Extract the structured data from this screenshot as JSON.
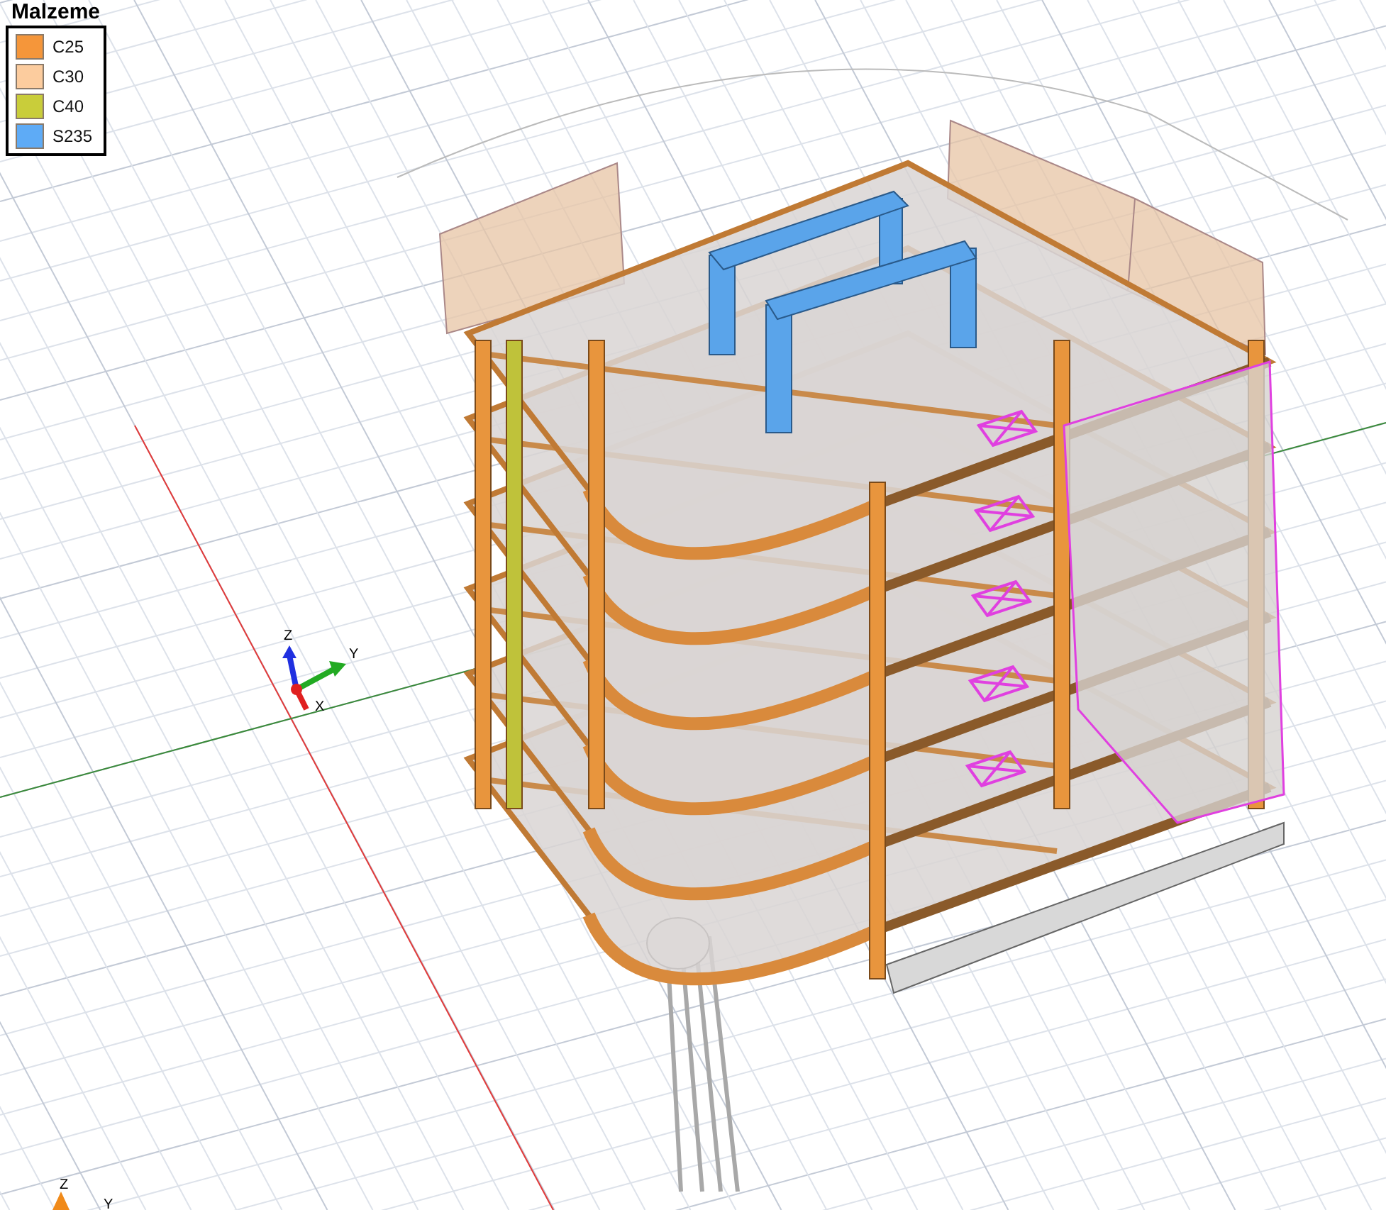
{
  "legend": {
    "title": "Malzeme",
    "items": [
      {
        "label": "C25",
        "color": "#f5963a"
      },
      {
        "label": "C30",
        "color": "#fccc9e"
      },
      {
        "label": "C40",
        "color": "#c9cd3a"
      },
      {
        "label": "S235",
        "color": "#5eabf6"
      }
    ]
  },
  "axis_triad": {
    "labels": [
      "Z",
      "Y",
      "X"
    ]
  },
  "corner_triad": {
    "labels": [
      "Z",
      "Y"
    ]
  }
}
